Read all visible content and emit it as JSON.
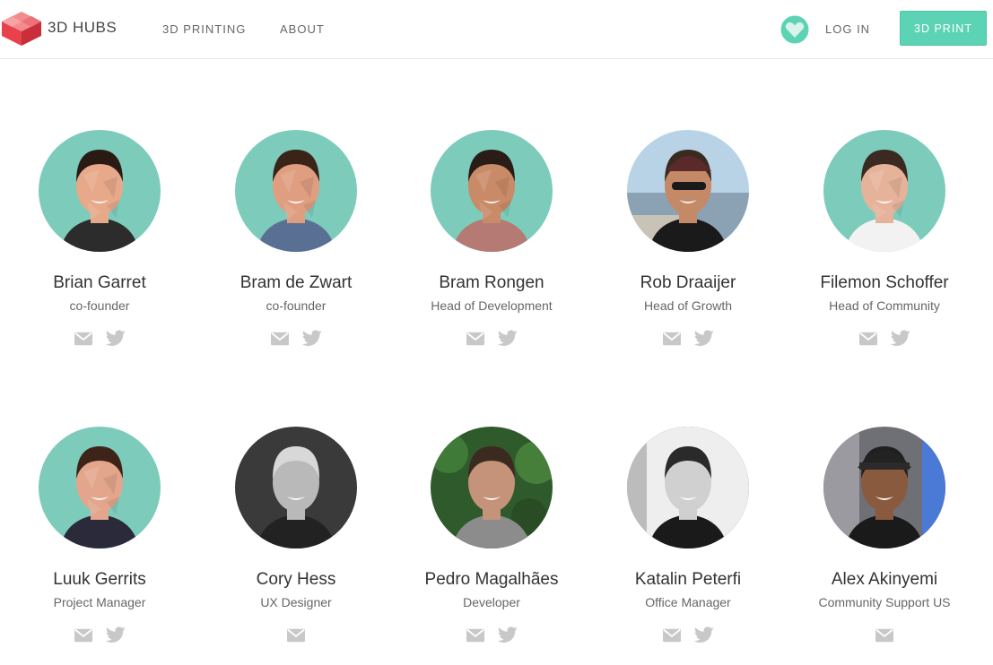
{
  "header": {
    "brand": "3D HUBS",
    "nav": [
      "3D PRINTING",
      "ABOUT"
    ],
    "login": "LOG IN",
    "cta": "3D PRINT",
    "accent_color": "#5dd3b6",
    "logo_color": "#e8414b"
  },
  "team": [
    {
      "name": "Brian Garret",
      "role": "co-founder",
      "photo_style": "lowpoly",
      "skin": "#e7a98a",
      "hair": "#2a1a14",
      "shirt": "#2c2c2c",
      "email": true,
      "twitter": true
    },
    {
      "name": "Bram de Zwart",
      "role": "co-founder",
      "photo_style": "lowpoly",
      "skin": "#df9e80",
      "hair": "#3a2418",
      "shirt": "#5a6f94",
      "email": true,
      "twitter": true
    },
    {
      "name": "Bram Rongen",
      "role": "Head of Development",
      "photo_style": "lowpoly",
      "skin": "#c98a68",
      "hair": "#2a1c16",
      "shirt": "#b57a74",
      "email": true,
      "twitter": true
    },
    {
      "name": "Rob Draaijer",
      "role": "Head of Growth",
      "photo_style": "photo-outdoor",
      "skin": "#c48a68",
      "hair": "#3a2a20",
      "shirt": "#1a1a1a",
      "email": true,
      "twitter": true
    },
    {
      "name": "Filemon Schoffer",
      "role": "Head of Community",
      "photo_style": "lowpoly",
      "skin": "#e6b39a",
      "hair": "#3a2a22",
      "shirt": "#f2f2f2",
      "email": true,
      "twitter": true
    },
    {
      "name": "Luuk Gerrits",
      "role": "Project Manager",
      "photo_style": "lowpoly",
      "skin": "#e3a68c",
      "hair": "#3e2418",
      "shirt": "#2a2a3a",
      "email": true,
      "twitter": true
    },
    {
      "name": "Cory Hess",
      "role": "UX Designer",
      "photo_style": "photo-bw",
      "skin": "#b9b9b9",
      "hair": "#d8d8d8",
      "shirt": "#222222",
      "email": true,
      "twitter": false
    },
    {
      "name": "Pedro Magalhães",
      "role": "Developer",
      "photo_style": "photo-green",
      "skin": "#c5927a",
      "hair": "#3a2a20",
      "shirt": "#8c8c8c",
      "email": true,
      "twitter": true
    },
    {
      "name": "Katalin Peterfi",
      "role": "Office Manager",
      "photo_style": "photo-bw",
      "skin": "#d0d0d0",
      "hair": "#2a2a2a",
      "shirt": "#1a1a1a",
      "email": true,
      "twitter": true
    },
    {
      "name": "Alex Akinyemi",
      "role": "Community Support US",
      "photo_style": "photo-street",
      "skin": "#8a5a3e",
      "hair": "#1f1f1f",
      "shirt": "#1a1a1a",
      "email": true,
      "twitter": false
    }
  ]
}
